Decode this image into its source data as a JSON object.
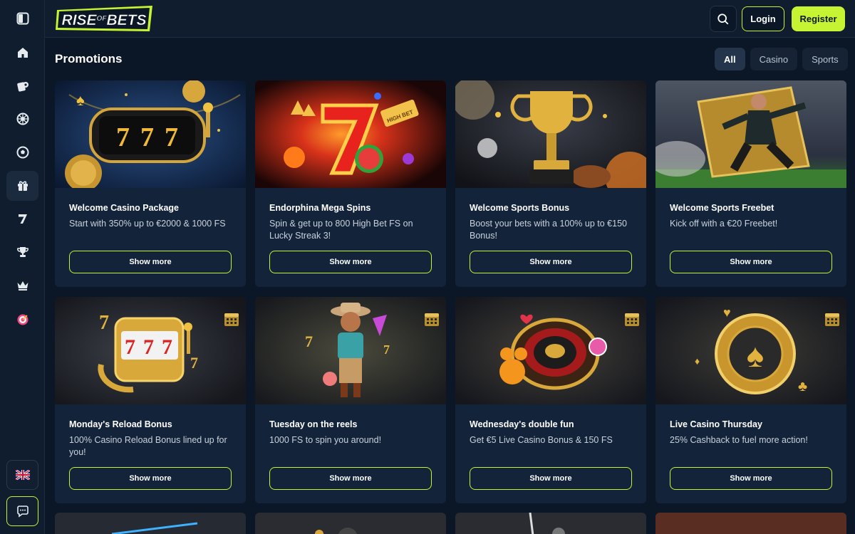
{
  "brand": {
    "logo_text": "RISE OF BETS",
    "accent": "#c6f432",
    "bg": "#0b1726"
  },
  "header": {
    "login_label": "Login",
    "register_label": "Register"
  },
  "page": {
    "title": "Promotions"
  },
  "filters": [
    {
      "label": "All",
      "active": true
    },
    {
      "label": "Casino",
      "active": false
    },
    {
      "label": "Sports",
      "active": false
    }
  ],
  "sidebar": {
    "items": [
      {
        "icon": "panel-toggle-icon"
      },
      {
        "icon": "home-icon"
      },
      {
        "icon": "casino-chips-icon"
      },
      {
        "icon": "roulette-icon"
      },
      {
        "icon": "soccer-ball-icon"
      },
      {
        "icon": "gift-icon",
        "active": true
      },
      {
        "icon": "seven-icon"
      },
      {
        "icon": "trophy-icon"
      },
      {
        "icon": "crown-icon"
      },
      {
        "icon": "target-icon"
      }
    ],
    "language_icon": "uk-flag-icon",
    "chat_icon": "chat-icon"
  },
  "promotions": [
    {
      "title": "Welcome Casino Package",
      "description": "Start with 350% up to €2000 & 1000 FS",
      "button": "Show more",
      "image": "slot-777-machine"
    },
    {
      "title": "Endorphina Mega Spins",
      "description": "Spin & get up to 800 High Bet FS on Lucky Streak 3!",
      "button": "Show more",
      "image": "lucky-seven-fire"
    },
    {
      "title": "Welcome Sports Bonus",
      "description": "Boost your bets with a 100% up to €150 Bonus!",
      "button": "Show more",
      "image": "gold-trophy"
    },
    {
      "title": "Welcome Sports Freebet",
      "description": "Kick off with a €20 Freebet!",
      "button": "Show more",
      "image": "soccer-player-ticket"
    },
    {
      "title": "Monday's Reload Bonus",
      "description": "100% Casino Reload Bonus lined up for you!",
      "button": "Show more",
      "image": "gold-slot-machine",
      "calendar": true
    },
    {
      "title": "Tuesday on the reels",
      "description": "1000 FS to spin you around!",
      "button": "Show more",
      "image": "cowboy-character",
      "calendar": true
    },
    {
      "title": "Wednesday's double fun",
      "description": "Get €5 Live Casino Bonus & 150 FS",
      "button": "Show more",
      "image": "roulette-wheel",
      "calendar": true
    },
    {
      "title": "Live Casino Thursday",
      "description": "25% Cashback to fuel more action!",
      "button": "Show more",
      "image": "gold-poker-chip",
      "calendar": true
    }
  ]
}
